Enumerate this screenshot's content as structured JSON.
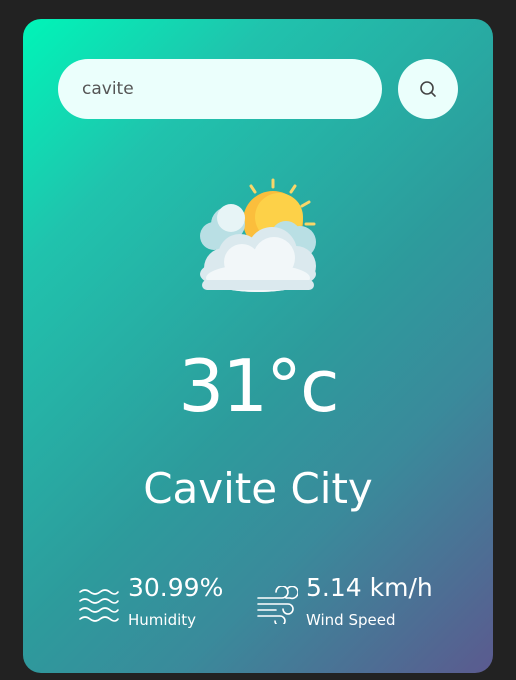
{
  "search": {
    "value": "cavite",
    "button_icon": "search-icon"
  },
  "weather": {
    "icon": "partly-cloudy-sun-icon",
    "temperature": "31°c",
    "city": "Cavite City"
  },
  "details": {
    "humidity": {
      "value": "30.99%",
      "label": "Humidity",
      "icon": "humidity-waves-icon"
    },
    "wind": {
      "value": "5.14 km/h",
      "label": "Wind Speed",
      "icon": "wind-icon"
    }
  },
  "colors": {
    "background": "#222222",
    "gradient_start": "#00f5b8",
    "gradient_end": "#5b5a8f",
    "input_bg": "#ebfffc",
    "text": "#ffffff"
  }
}
